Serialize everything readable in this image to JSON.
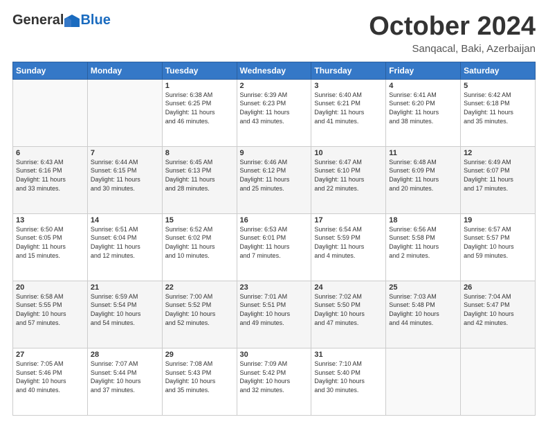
{
  "logo": {
    "general": "General",
    "blue": "Blue"
  },
  "header": {
    "month": "October 2024",
    "location": "Sanqacal, Baki, Azerbaijan"
  },
  "weekdays": [
    "Sunday",
    "Monday",
    "Tuesday",
    "Wednesday",
    "Thursday",
    "Friday",
    "Saturday"
  ],
  "weeks": [
    [
      {
        "num": "",
        "info": ""
      },
      {
        "num": "",
        "info": ""
      },
      {
        "num": "1",
        "info": "Sunrise: 6:38 AM\nSunset: 6:25 PM\nDaylight: 11 hours\nand 46 minutes."
      },
      {
        "num": "2",
        "info": "Sunrise: 6:39 AM\nSunset: 6:23 PM\nDaylight: 11 hours\nand 43 minutes."
      },
      {
        "num": "3",
        "info": "Sunrise: 6:40 AM\nSunset: 6:21 PM\nDaylight: 11 hours\nand 41 minutes."
      },
      {
        "num": "4",
        "info": "Sunrise: 6:41 AM\nSunset: 6:20 PM\nDaylight: 11 hours\nand 38 minutes."
      },
      {
        "num": "5",
        "info": "Sunrise: 6:42 AM\nSunset: 6:18 PM\nDaylight: 11 hours\nand 35 minutes."
      }
    ],
    [
      {
        "num": "6",
        "info": "Sunrise: 6:43 AM\nSunset: 6:16 PM\nDaylight: 11 hours\nand 33 minutes."
      },
      {
        "num": "7",
        "info": "Sunrise: 6:44 AM\nSunset: 6:15 PM\nDaylight: 11 hours\nand 30 minutes."
      },
      {
        "num": "8",
        "info": "Sunrise: 6:45 AM\nSunset: 6:13 PM\nDaylight: 11 hours\nand 28 minutes."
      },
      {
        "num": "9",
        "info": "Sunrise: 6:46 AM\nSunset: 6:12 PM\nDaylight: 11 hours\nand 25 minutes."
      },
      {
        "num": "10",
        "info": "Sunrise: 6:47 AM\nSunset: 6:10 PM\nDaylight: 11 hours\nand 22 minutes."
      },
      {
        "num": "11",
        "info": "Sunrise: 6:48 AM\nSunset: 6:09 PM\nDaylight: 11 hours\nand 20 minutes."
      },
      {
        "num": "12",
        "info": "Sunrise: 6:49 AM\nSunset: 6:07 PM\nDaylight: 11 hours\nand 17 minutes."
      }
    ],
    [
      {
        "num": "13",
        "info": "Sunrise: 6:50 AM\nSunset: 6:05 PM\nDaylight: 11 hours\nand 15 minutes."
      },
      {
        "num": "14",
        "info": "Sunrise: 6:51 AM\nSunset: 6:04 PM\nDaylight: 11 hours\nand 12 minutes."
      },
      {
        "num": "15",
        "info": "Sunrise: 6:52 AM\nSunset: 6:02 PM\nDaylight: 11 hours\nand 10 minutes."
      },
      {
        "num": "16",
        "info": "Sunrise: 6:53 AM\nSunset: 6:01 PM\nDaylight: 11 hours\nand 7 minutes."
      },
      {
        "num": "17",
        "info": "Sunrise: 6:54 AM\nSunset: 5:59 PM\nDaylight: 11 hours\nand 4 minutes."
      },
      {
        "num": "18",
        "info": "Sunrise: 6:56 AM\nSunset: 5:58 PM\nDaylight: 11 hours\nand 2 minutes."
      },
      {
        "num": "19",
        "info": "Sunrise: 6:57 AM\nSunset: 5:57 PM\nDaylight: 10 hours\nand 59 minutes."
      }
    ],
    [
      {
        "num": "20",
        "info": "Sunrise: 6:58 AM\nSunset: 5:55 PM\nDaylight: 10 hours\nand 57 minutes."
      },
      {
        "num": "21",
        "info": "Sunrise: 6:59 AM\nSunset: 5:54 PM\nDaylight: 10 hours\nand 54 minutes."
      },
      {
        "num": "22",
        "info": "Sunrise: 7:00 AM\nSunset: 5:52 PM\nDaylight: 10 hours\nand 52 minutes."
      },
      {
        "num": "23",
        "info": "Sunrise: 7:01 AM\nSunset: 5:51 PM\nDaylight: 10 hours\nand 49 minutes."
      },
      {
        "num": "24",
        "info": "Sunrise: 7:02 AM\nSunset: 5:50 PM\nDaylight: 10 hours\nand 47 minutes."
      },
      {
        "num": "25",
        "info": "Sunrise: 7:03 AM\nSunset: 5:48 PM\nDaylight: 10 hours\nand 44 minutes."
      },
      {
        "num": "26",
        "info": "Sunrise: 7:04 AM\nSunset: 5:47 PM\nDaylight: 10 hours\nand 42 minutes."
      }
    ],
    [
      {
        "num": "27",
        "info": "Sunrise: 7:05 AM\nSunset: 5:46 PM\nDaylight: 10 hours\nand 40 minutes."
      },
      {
        "num": "28",
        "info": "Sunrise: 7:07 AM\nSunset: 5:44 PM\nDaylight: 10 hours\nand 37 minutes."
      },
      {
        "num": "29",
        "info": "Sunrise: 7:08 AM\nSunset: 5:43 PM\nDaylight: 10 hours\nand 35 minutes."
      },
      {
        "num": "30",
        "info": "Sunrise: 7:09 AM\nSunset: 5:42 PM\nDaylight: 10 hours\nand 32 minutes."
      },
      {
        "num": "31",
        "info": "Sunrise: 7:10 AM\nSunset: 5:40 PM\nDaylight: 10 hours\nand 30 minutes."
      },
      {
        "num": "",
        "info": ""
      },
      {
        "num": "",
        "info": ""
      }
    ]
  ]
}
